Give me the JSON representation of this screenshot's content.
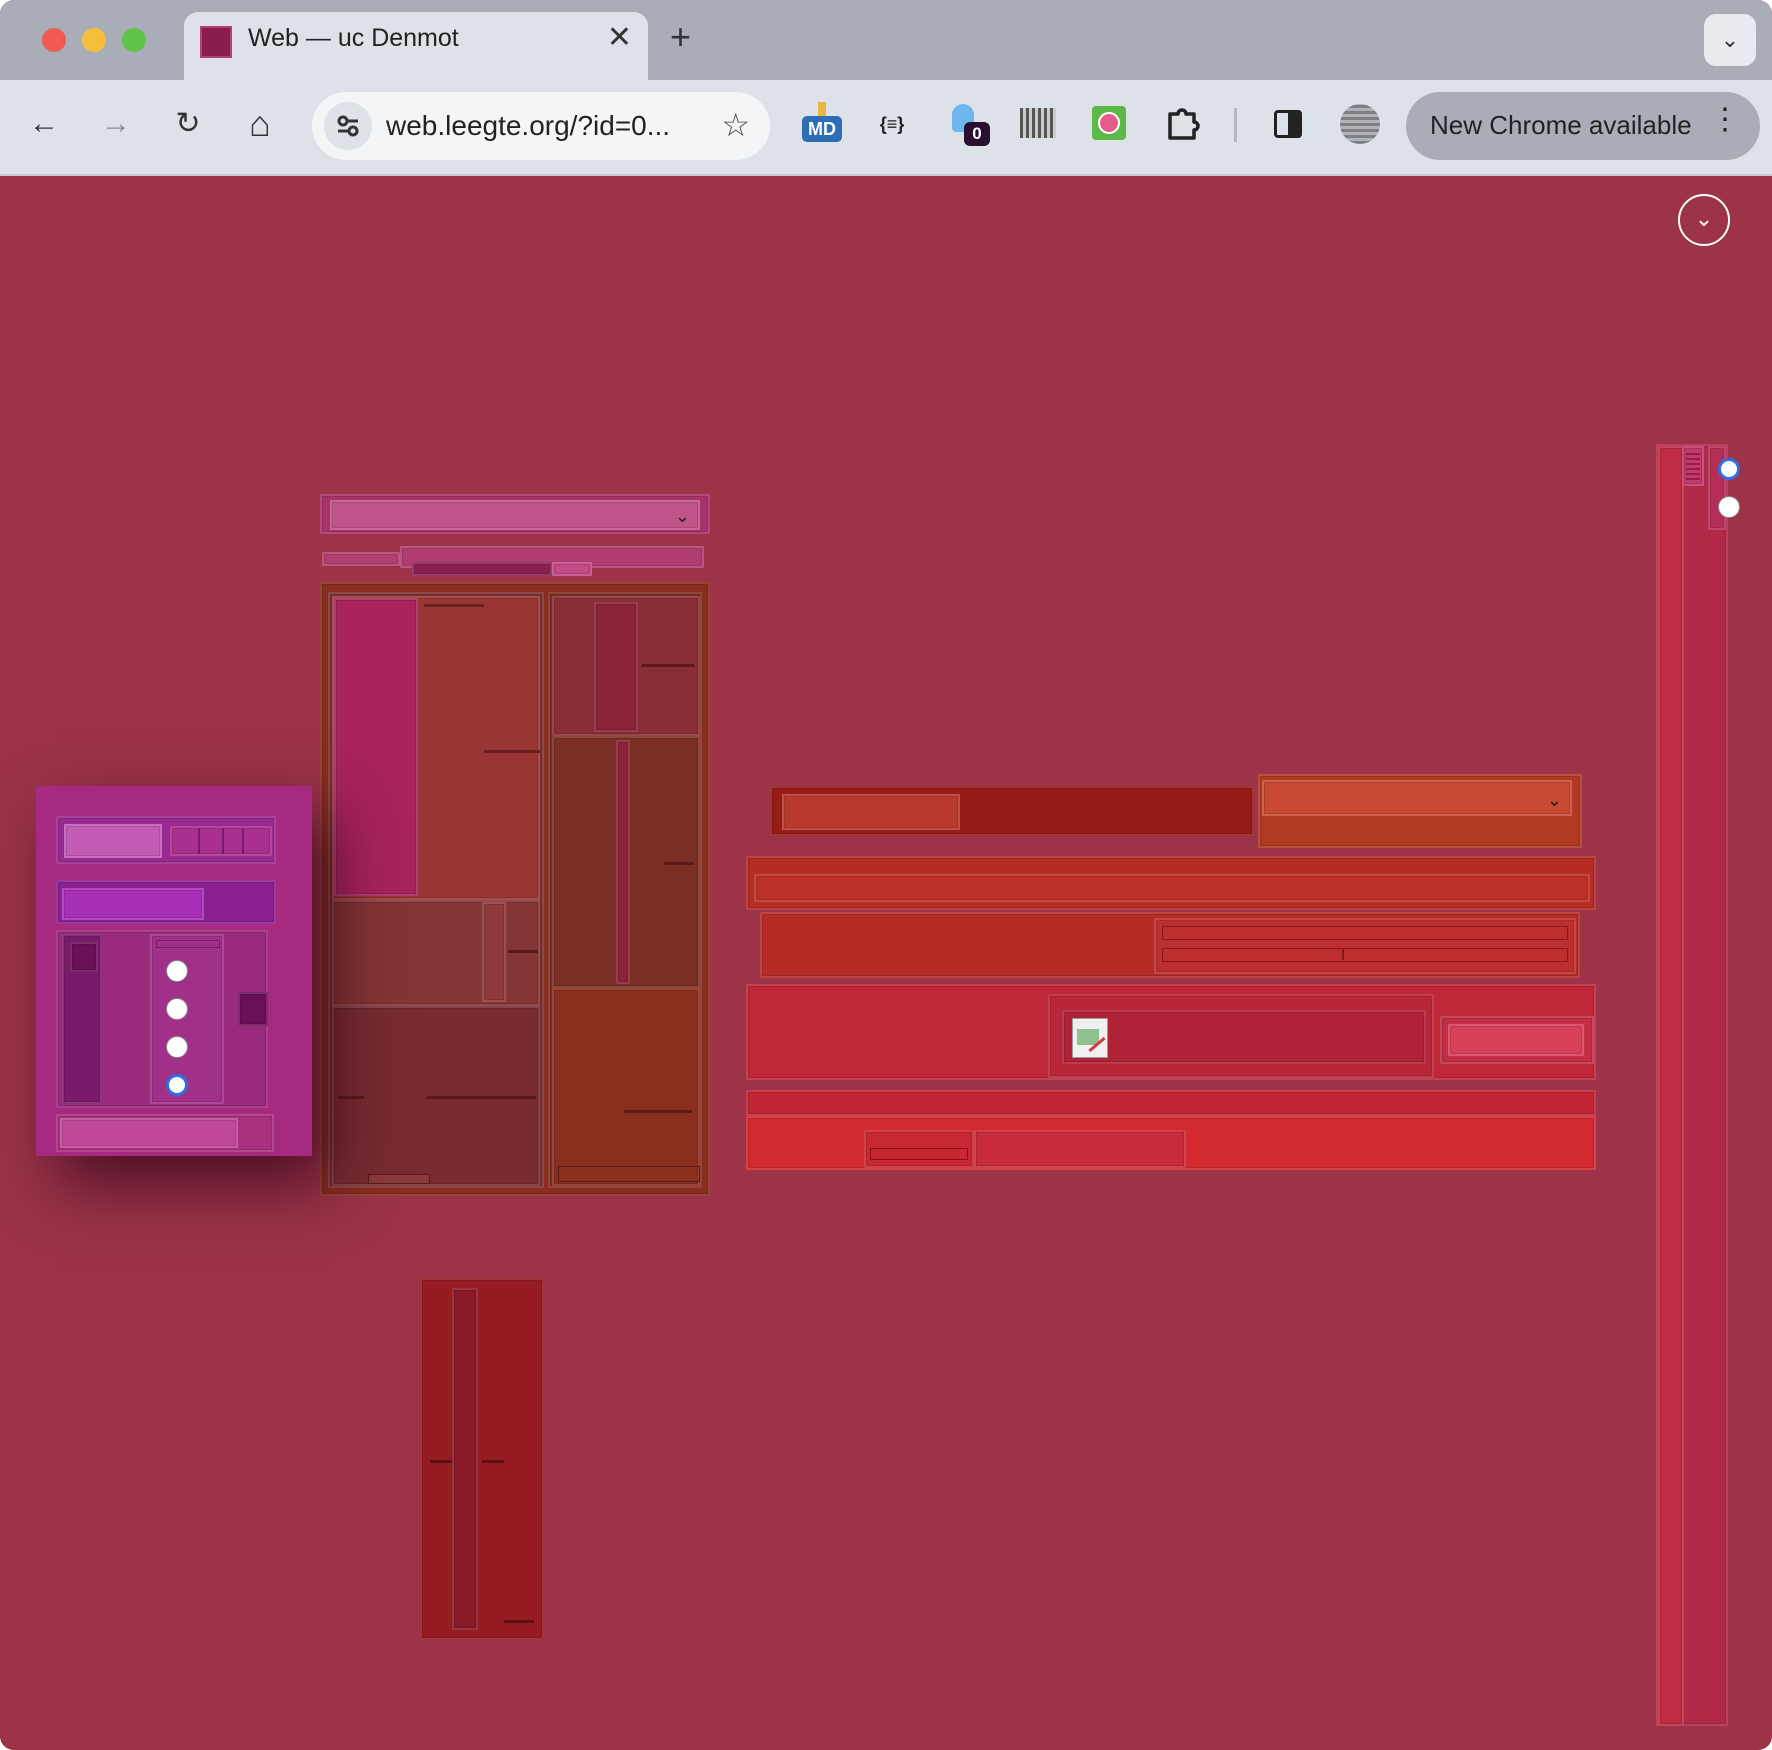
{
  "browser": {
    "tab_title": "Web — uc Denmot",
    "tab_close": "✕",
    "new_tab": "+",
    "tab_search": "⌄",
    "url": "web.leegte.org/?id=0...",
    "bookmark_star": "☆",
    "back": "←",
    "forward": "→",
    "reload": "↻",
    "home": "⌂",
    "extensions": {
      "md_label": "MD",
      "json_label": "{≡}",
      "ghost_badge": "0"
    },
    "update_label": "New Chrome available",
    "menu_dots": "⋮",
    "colors": {
      "tab_strip": "#a9adb8",
      "toolbar": "#dde1e8",
      "page_bg": "#9c3349"
    }
  },
  "page": {
    "scroll_down": "⌄",
    "select_chevron": "⌄",
    "radios_left": [
      false,
      false,
      false,
      true
    ],
    "radios_right": [
      true,
      false
    ]
  }
}
